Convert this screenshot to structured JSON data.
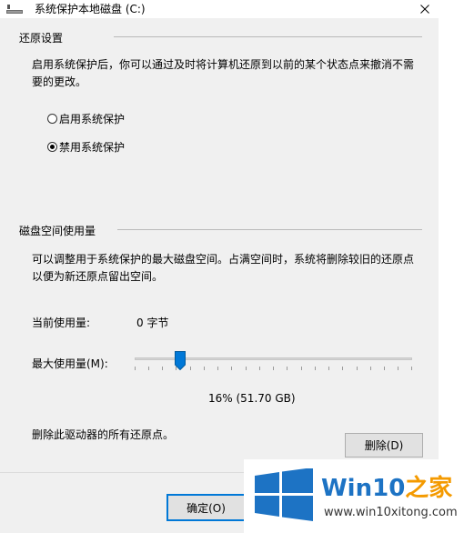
{
  "window": {
    "title": "系统保护本地磁盘 (C:)",
    "close_glyph": "✕"
  },
  "restore_settings": {
    "group_title": "还原设置",
    "description": "启用系统保护后，你可以通过及时将计算机还原到以前的某个状态点来撤消不需要的更改。",
    "options": [
      {
        "label": "启用系统保护",
        "checked": false
      },
      {
        "label": "禁用系统保护",
        "checked": true
      }
    ]
  },
  "disk_usage": {
    "group_title": "磁盘空间使用量",
    "description": "可以调整用于系统保护的最大磁盘空间。占满空间时，系统将删除较旧的还原点以便为新还原点留出空间。",
    "current_usage_label": "当前使用量:",
    "current_usage_value": "0 字节",
    "max_usage_label": "最大使用量(M):",
    "slider_percent": 16,
    "slider_readout": "16% (51.70 GB)",
    "delete_text": "删除此驱动器的所有还原点。",
    "delete_button": "删除(D)"
  },
  "footer": {
    "ok_button": "确定(O)"
  },
  "watermark": {
    "brand_main": "Win10",
    "brand_accent": "之家",
    "url": "www.win10xitong.com",
    "colors": {
      "blue": "#1d73c4",
      "orange": "#f49a00"
    }
  },
  "icons": {
    "titlebar": "drive-icon",
    "close": "close-icon",
    "logo": "windows-logo-icon"
  }
}
